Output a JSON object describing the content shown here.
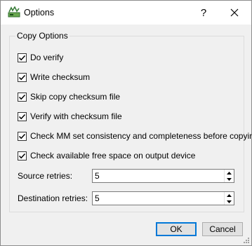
{
  "window": {
    "title": "Options",
    "help_label": "?"
  },
  "group": {
    "title": "Copy Options",
    "checkboxes": [
      {
        "label": "Do verify",
        "checked": true
      },
      {
        "label": "Write checksum",
        "checked": true
      },
      {
        "label": "Skip copy checksum file",
        "checked": true
      },
      {
        "label": "Verify with checksum file",
        "checked": true
      },
      {
        "label": "Check MM set consistency and completeness before copying",
        "checked": true
      },
      {
        "label": "Check available free space on output device",
        "checked": true
      }
    ],
    "source_retries": {
      "label": "Source retries:",
      "value": "5"
    },
    "destination_retries": {
      "label": "Destination retries:",
      "value": "5"
    }
  },
  "buttons": {
    "ok_label": "OK",
    "cancel_label": "Cancel"
  },
  "colors": {
    "accent": "#0078d7",
    "dialog_bg": "#f0f0f0"
  }
}
